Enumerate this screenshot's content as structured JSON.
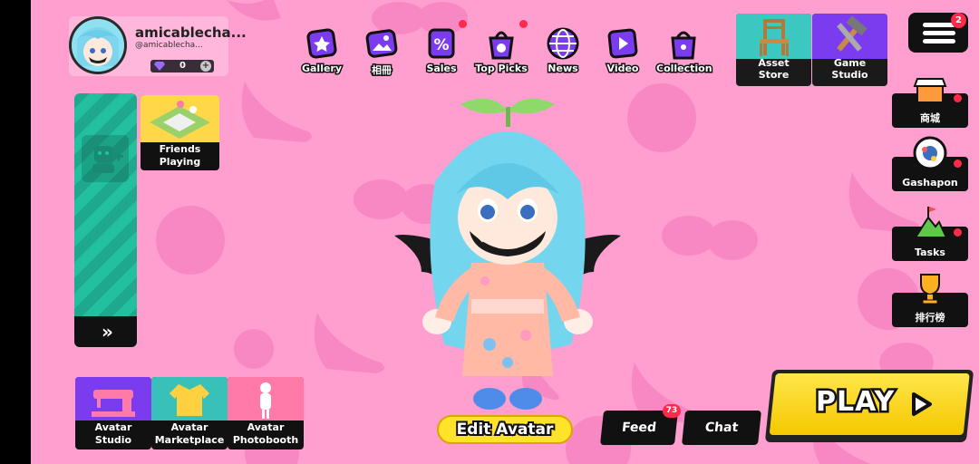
{
  "profile": {
    "username": "amicablecha...",
    "handle": "@amicablecha...",
    "currency_value": "0",
    "currency_add": "+"
  },
  "top_nav": [
    {
      "label": "Gallery",
      "icon": "gallery-icon"
    },
    {
      "label": "相冊",
      "icon": "album-icon"
    },
    {
      "label": "Sales",
      "icon": "sales-icon"
    },
    {
      "label": "Top Picks",
      "icon": "top-picks-icon"
    },
    {
      "label": "News",
      "icon": "news-icon"
    },
    {
      "label": "Video",
      "icon": "video-icon"
    },
    {
      "label": "Collection",
      "icon": "collection-icon"
    }
  ],
  "studios": {
    "asset_store_line1": "Asset",
    "asset_store_line2": "Store",
    "game_studio_line1": "Game",
    "game_studio_line2": "Studio"
  },
  "menu": {
    "badge": "2"
  },
  "friends": {
    "tile_line1": "Friends",
    "tile_line2": "Playing",
    "expand": "»"
  },
  "bottom_tiles": [
    {
      "line1": "Avatar",
      "line2": "Studio"
    },
    {
      "line1": "Avatar",
      "line2": "Marketplace"
    },
    {
      "line1": "Avatar",
      "line2": "Photobooth"
    }
  ],
  "side_buttons": [
    {
      "label": "商城",
      "icon": "shop-icon"
    },
    {
      "label": "Gashapon",
      "icon": "gashapon-icon"
    },
    {
      "label": "Tasks",
      "icon": "tasks-icon"
    },
    {
      "label": "排行榜",
      "icon": "trophy-icon"
    }
  ],
  "actions": {
    "edit_avatar": "Edit Avatar",
    "feed": "Feed",
    "feed_badge": "73",
    "chat": "Chat",
    "play": "PLAY"
  },
  "colors": {
    "background": "#ff9fcf",
    "accent_yellow": "#ffe22a",
    "dark": "#111111",
    "badge_red": "#ff2a4a",
    "nav_purple": "#7b3cf0"
  }
}
